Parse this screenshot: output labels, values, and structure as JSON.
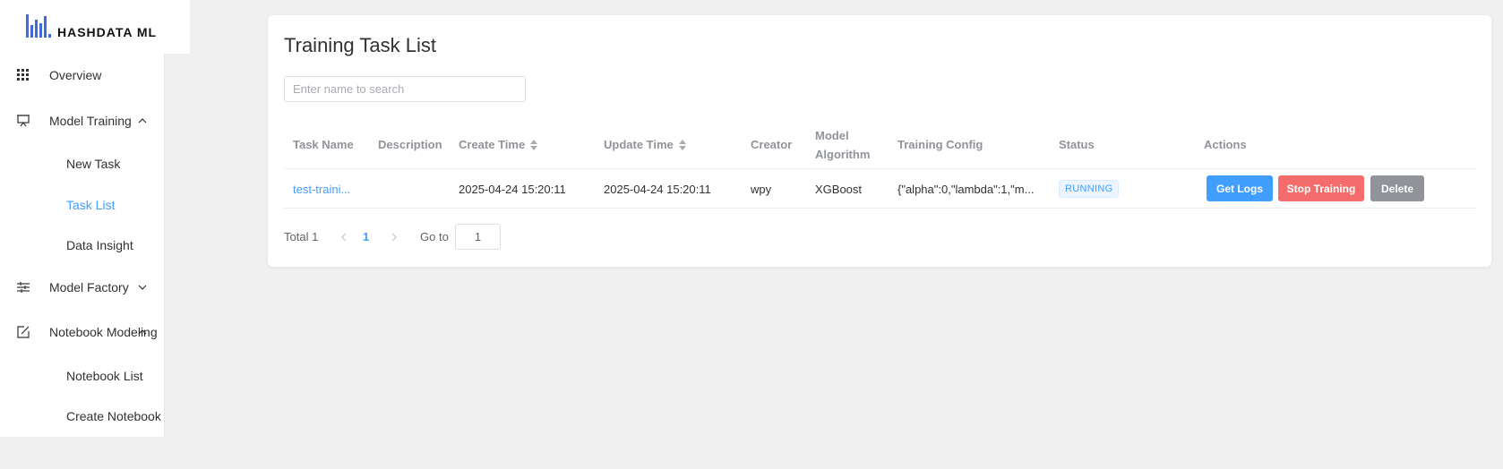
{
  "brand": {
    "name": "HASHDATA ML",
    "accent": "#409eff"
  },
  "sidebar": {
    "items": [
      {
        "label": "Overview",
        "icon": "grid-icon"
      },
      {
        "label": "Model Training",
        "icon": "board-icon",
        "expanded": true,
        "children": [
          {
            "label": "New Task"
          },
          {
            "label": "Task List",
            "active": true
          },
          {
            "label": "Data Insight"
          }
        ]
      },
      {
        "label": "Model Factory",
        "icon": "sliders-icon",
        "expanded": false
      },
      {
        "label": "Notebook Modeling",
        "icon": "edit-icon",
        "expanded": true,
        "children": [
          {
            "label": "Notebook List"
          },
          {
            "label": "Create Notebook"
          }
        ]
      }
    ]
  },
  "main": {
    "title": "Training Task List",
    "search": {
      "placeholder": "Enter name to search",
      "value": ""
    },
    "table": {
      "columns": [
        "Task Name",
        "Description",
        "Create Time",
        "Update Time",
        "Creator",
        "Model Algorithm",
        "Training Config",
        "Status",
        "Actions"
      ],
      "rows": [
        {
          "task_name": "test-traini...",
          "description": "",
          "create_time": "2025-04-24 15:20:11",
          "update_time": "2025-04-24 15:20:11",
          "creator": "wpy",
          "model_algorithm": "XGBoost",
          "training_config": "{\"alpha\":0,\"lambda\":1,\"m...",
          "status": "RUNNING",
          "actions": [
            "Get Logs",
            "Stop Training",
            "Delete"
          ]
        }
      ]
    },
    "pagination": {
      "total_label": "Total 1",
      "current_page": "1",
      "goto_label": "Go to",
      "goto_value": "1"
    }
  },
  "colors": {
    "primary": "#409eff",
    "danger": "#f56c6c",
    "info": "#909399"
  }
}
